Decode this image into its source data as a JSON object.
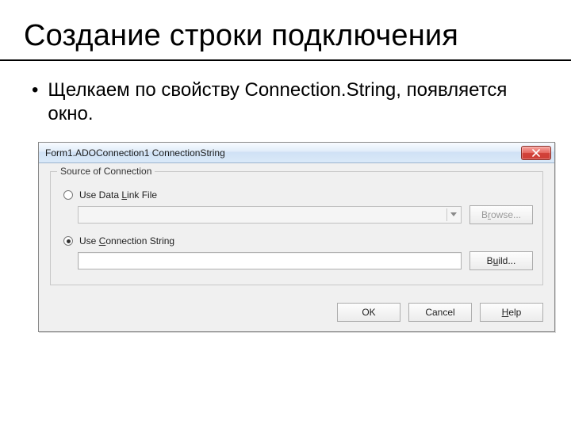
{
  "slide": {
    "title": "Создание строки подключения",
    "bullet": "Щелкаем по свойству Connection.String, появляется окно."
  },
  "dialog": {
    "title": "Form1.ADOConnection1 ConnectionString",
    "group_legend": "Source of Connection",
    "radio_datalink": {
      "pre": "Use Data ",
      "u": "L",
      "post": "ink File",
      "selected": false
    },
    "radio_connstr": {
      "pre": "Use ",
      "u": "C",
      "post": "onnection String",
      "selected": true
    },
    "combo_value": "",
    "connstr_value": "",
    "buttons": {
      "browse": {
        "pre": "B",
        "u": "r",
        "post": "owse..."
      },
      "build": {
        "pre": "B",
        "u": "u",
        "post": "ild..."
      },
      "ok": "OK",
      "cancel": "Cancel",
      "help": {
        "pre": "",
        "u": "H",
        "post": "elp"
      }
    }
  }
}
